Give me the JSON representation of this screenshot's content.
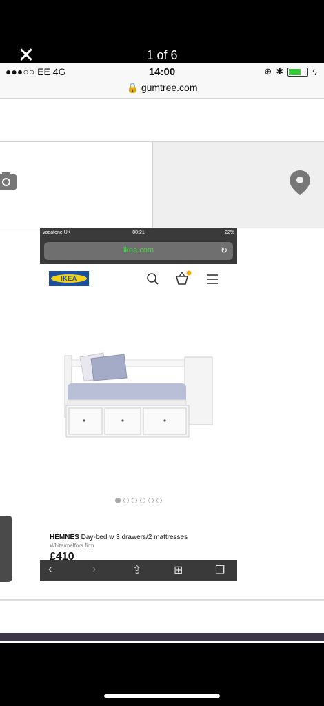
{
  "viewer": {
    "close_glyph": "✕",
    "counter": "1 of 6"
  },
  "status": {
    "carrier": "●●●○○ EE   4G",
    "time": "14:00",
    "url": "gumtree.com",
    "icons": [
      "lock-rotation-icon",
      "bluetooth-icon",
      "battery-icon",
      "charging-icon"
    ]
  },
  "tiles": {
    "left_icon": "camera-icon",
    "right_icon": "location-pin-icon"
  },
  "embedded": {
    "status": {
      "carrier": "vodafone UK",
      "time": "00:21",
      "battery": "22%"
    },
    "url": "ikea.com",
    "logo": "IKEA",
    "nav_icons": [
      "search-icon",
      "basket-icon",
      "menu-icon"
    ],
    "carousel": {
      "count": 6,
      "active": 0
    },
    "product": {
      "name": "HEMNES",
      "description": "Day-bed w 3 drawers/2 mattresses",
      "variant": "White/malfors firm",
      "price": "£410"
    },
    "toolbar_icons": [
      "back-icon",
      "forward-icon",
      "share-icon",
      "bookmarks-icon",
      "tabs-icon"
    ]
  },
  "colors": {
    "ikea_blue": "#1b4fa0",
    "ikea_yellow": "#f3d21c",
    "secure_green": "#49d249"
  }
}
